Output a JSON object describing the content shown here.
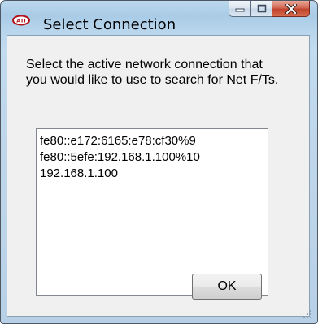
{
  "window": {
    "title": "Select Connection",
    "app_icon": "ati-logo-icon",
    "caption_buttons": {
      "minimize_icon": "minimize-icon",
      "maximize_icon": "maximize-icon",
      "close_icon": "close-icon"
    }
  },
  "dialog": {
    "prompt": "Select the active network connection that you would like to use to search for Net F/Ts.",
    "connections": [
      "fe80::e172:6165:e78:cf30%9",
      "fe80::5efe:192.168.1.100%10",
      "192.168.1.100"
    ],
    "ok_label": "OK"
  },
  "colors": {
    "frame_glass": "#b7d5ec",
    "client_bg": "#f0f0f0",
    "close_button": "#c0432c"
  }
}
